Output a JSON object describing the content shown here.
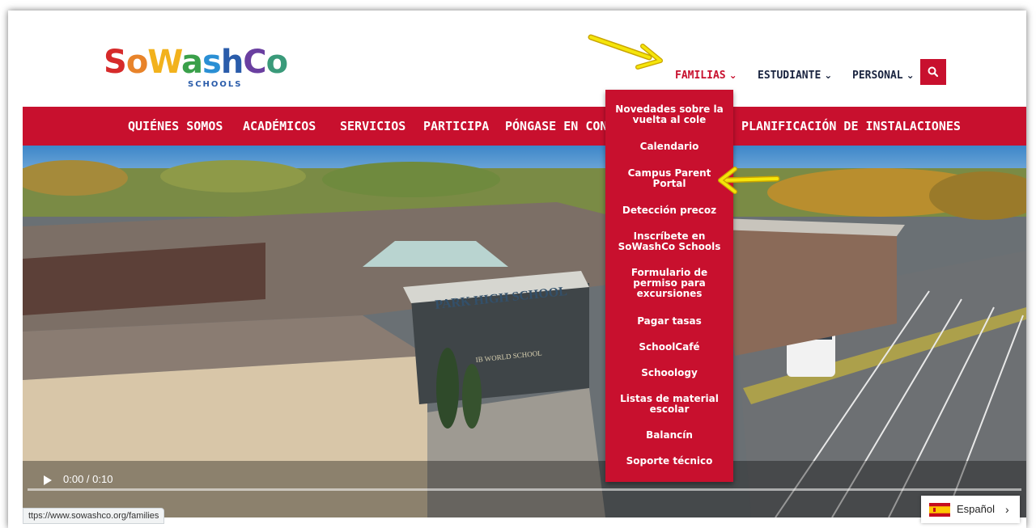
{
  "logo": {
    "letters": [
      {
        "ch": "S",
        "color": "#d62a2a"
      },
      {
        "ch": "o",
        "color": "#e8832a"
      },
      {
        "ch": "W",
        "color": "#f2b21d"
      },
      {
        "ch": "a",
        "color": "#3aa04a"
      },
      {
        "ch": "s",
        "color": "#2a8fd4"
      },
      {
        "ch": "h",
        "color": "#2a5caa"
      },
      {
        "ch": "C",
        "color": "#6a3fa0"
      },
      {
        "ch": "o",
        "color": "#3a9a7a"
      }
    ],
    "sub": "SCHOOLS"
  },
  "topnav": {
    "familias": "FAMILIAS",
    "estudiante": "ESTUDIANTE",
    "personal": "PERSONAL"
  },
  "mainnav": {
    "quienes": "QUIÉNES SOMOS",
    "academicos": "ACADÉMICOS",
    "servicios": "SERVICIOS",
    "participa": "PARTICIPA",
    "pongase": "PÓNGASE EN CONTA",
    "planificacion": "PLANIFICACIÓN DE INSTALACIONES"
  },
  "dropdown": {
    "items": [
      "Novedades sobre la vuelta al cole",
      "Calendario",
      "Campus Parent Portal",
      "Detección precoz",
      "Inscríbete en SoWashCo Schools",
      "Formulario de permiso para excursiones",
      "Pagar tasas",
      "SchoolCafé",
      "Schoology",
      "Listas de material escolar",
      "Balancín",
      "Soporte técnico"
    ]
  },
  "video": {
    "time": "0:00 / 0:10",
    "building_sign": "PARK HIGH SCHOOL",
    "sub_sign": "IB WORLD SCHOOL",
    "progress": 0
  },
  "statusbar": {
    "url": "ttps://www.sowashco.org/families"
  },
  "language": {
    "label": "Español",
    "arrow": "›"
  },
  "colors": {
    "brand_red": "#c8102e",
    "nav_text": "#1a2440",
    "annotation_arrow": "#f5e50a"
  }
}
